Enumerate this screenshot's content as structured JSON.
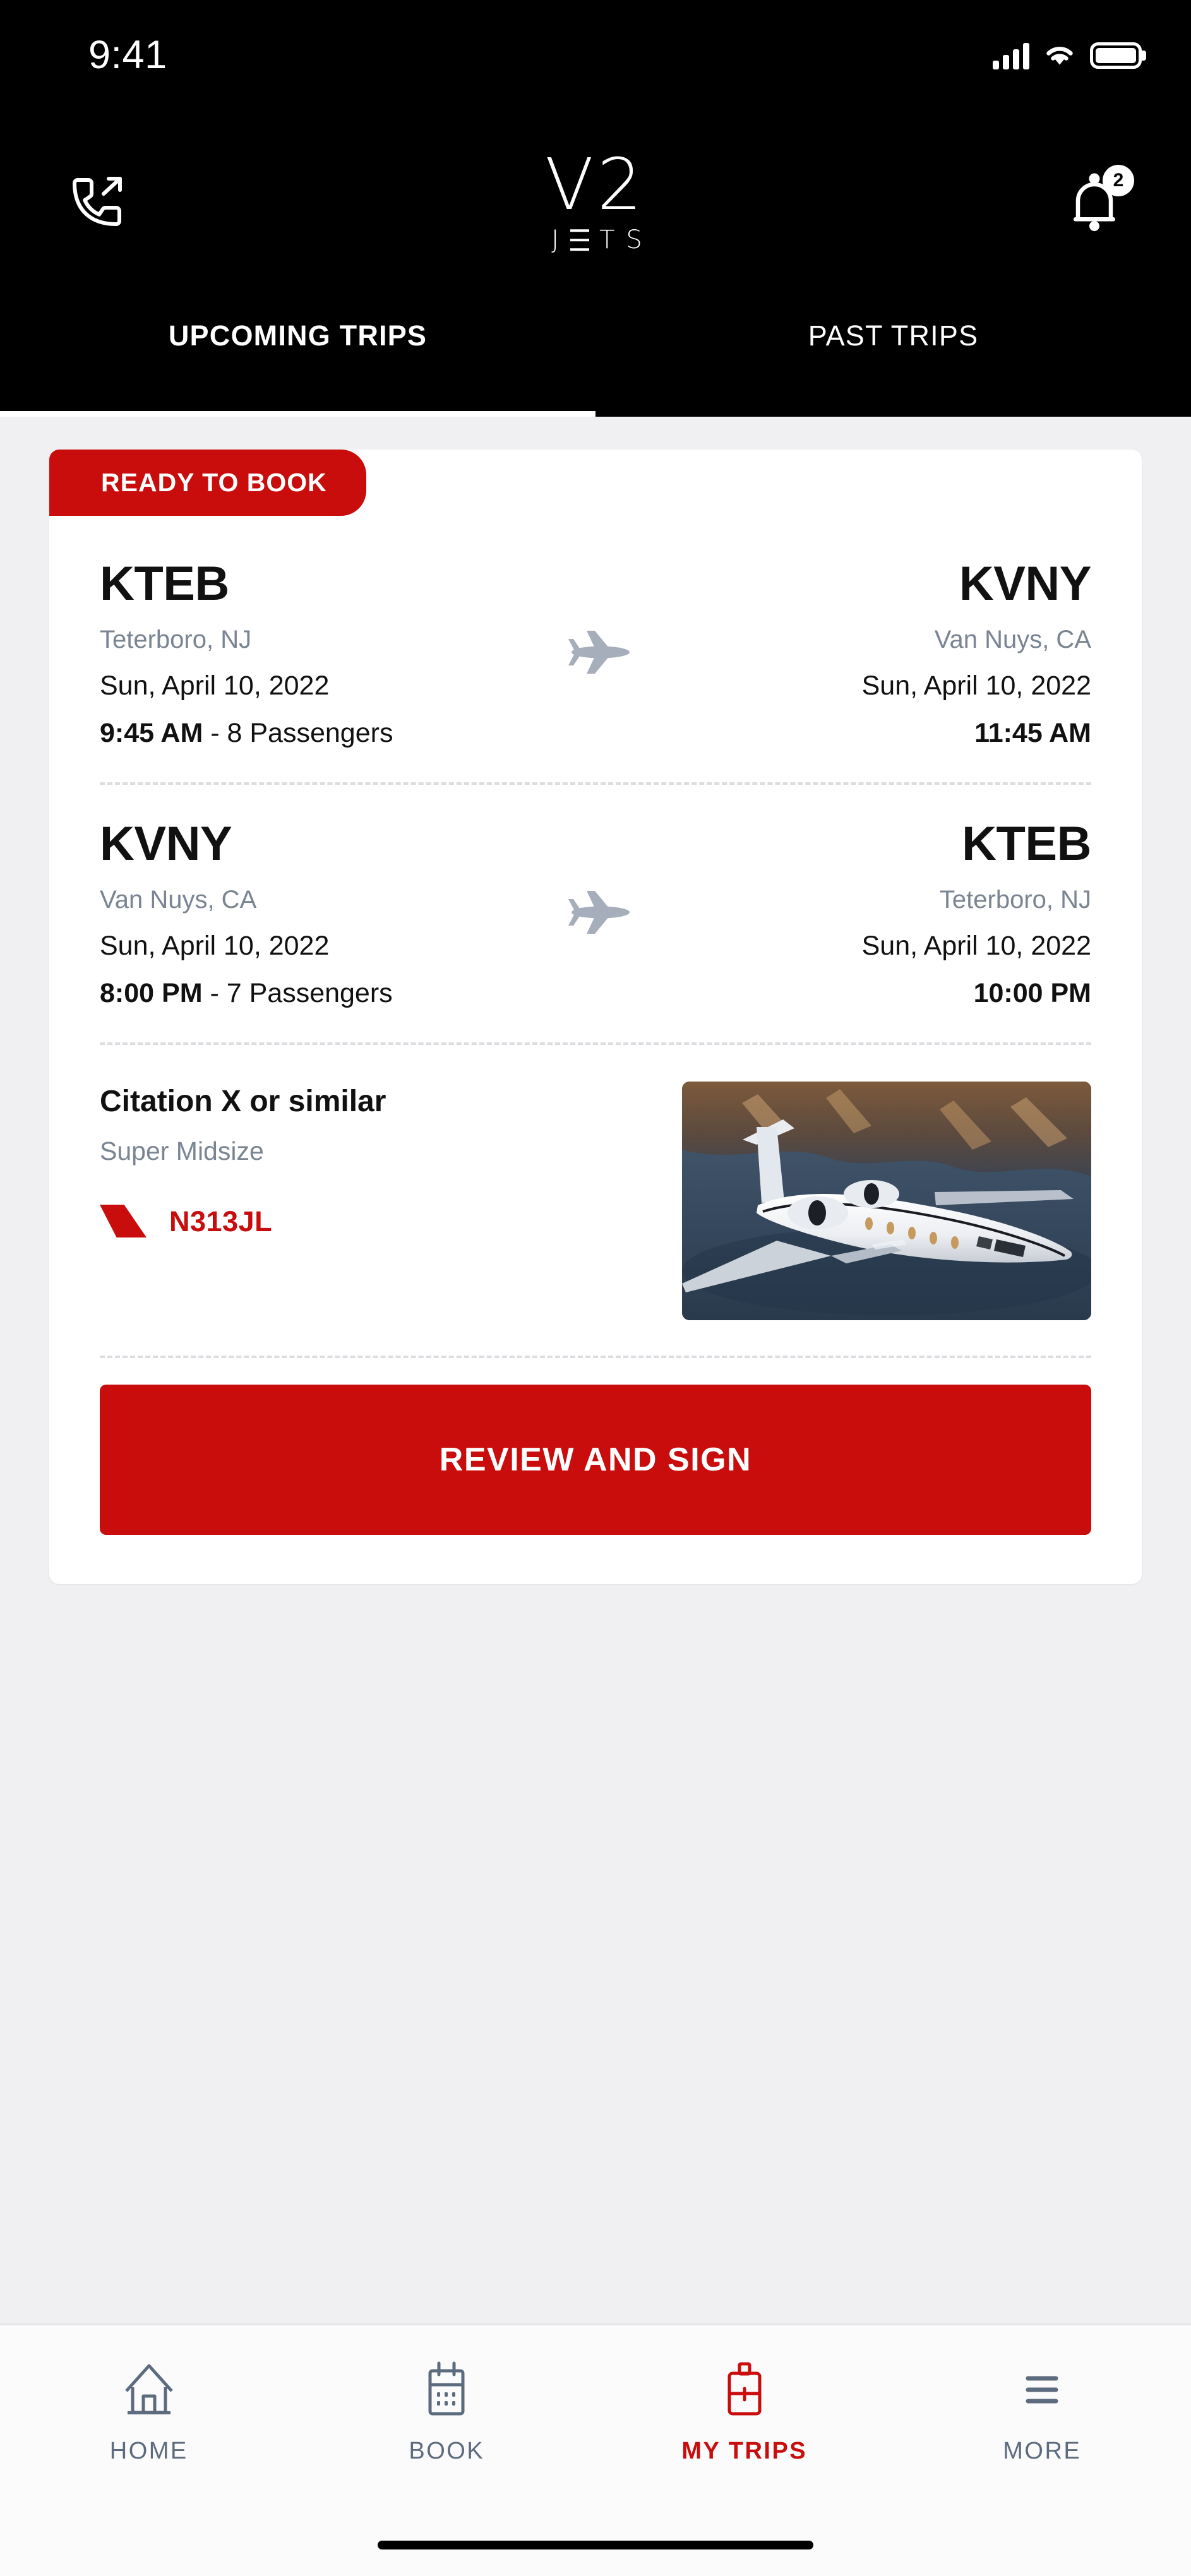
{
  "colors": {
    "brand_red": "#c90c0c",
    "header_black": "#000000",
    "page_bg": "#f0f0f2",
    "card_bg": "#ffffff",
    "muted_text": "#7a8492",
    "nav_inactive": "#5d6b7e"
  },
  "status_bar": {
    "time": "9:41",
    "signal_icon": "cellular-signal-icon",
    "wifi_icon": "wifi-icon",
    "battery_icon": "battery-icon"
  },
  "header": {
    "call_icon": "phone-outgoing-icon",
    "notifications_icon": "bell-icon",
    "notifications_count": "2",
    "logo": {
      "primary": "V2",
      "secondary_j": "J",
      "secondary_e": "E",
      "secondary_t": "T",
      "secondary_s": "S",
      "full_text": "V2 JETS"
    }
  },
  "tabs": [
    {
      "label": "UPCOMING TRIPS",
      "active": true
    },
    {
      "label": "PAST TRIPS",
      "active": false
    }
  ],
  "trip_card": {
    "status_badge": "READY TO BOOK",
    "plane_icon": "airplane-icon",
    "legs": [
      {
        "departure": {
          "code": "KTEB",
          "city": "Teterboro, NJ",
          "date": "Sun, April 10, 2022",
          "time": "9:45 AM",
          "passengers": "- 8 Passengers"
        },
        "arrival": {
          "code": "KVNY",
          "city": "Van Nuys, CA",
          "date": "Sun, April 10, 2022",
          "time": "11:45 AM"
        }
      },
      {
        "departure": {
          "code": "KVNY",
          "city": "Van Nuys, CA",
          "date": "Sun, April 10, 2022",
          "time": "8:00 PM",
          "passengers": "- 7 Passengers"
        },
        "arrival": {
          "code": "KTEB",
          "city": "Teterboro, NJ",
          "date": "Sun, April 10, 2022",
          "time": "10:00 PM"
        }
      }
    ],
    "aircraft": {
      "name": "Citation X or similar",
      "category": "Super Midsize",
      "tail_icon": "tail-fin-icon",
      "tail_number": "N313JL",
      "photo_alt": "business-jet-photo"
    },
    "cta_label": "REVIEW AND SIGN"
  },
  "bottom_nav": [
    {
      "label": "HOME",
      "icon": "home-icon",
      "active": false
    },
    {
      "label": "BOOK",
      "icon": "calendar-icon",
      "active": false
    },
    {
      "label": "MY TRIPS",
      "icon": "briefcase-icon",
      "active": true
    },
    {
      "label": "MORE",
      "icon": "hamburger-menu-icon",
      "active": false
    }
  ]
}
